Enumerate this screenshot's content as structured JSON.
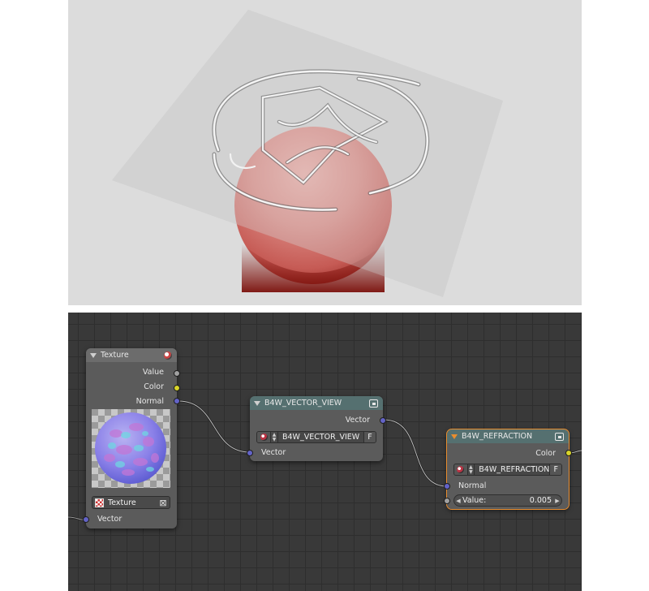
{
  "viewport": {
    "colors": {
      "background": "#dcdcdc",
      "sphere": "#c86a6a",
      "sphere_shadow": "#8a1a14",
      "glass_plane": "#cfcfcf"
    }
  },
  "node_editor": {
    "colors": {
      "grid": "#393939",
      "node_body": "#5b5b5b",
      "active_outline": "#e98d2e",
      "socket_vector": "#6363c7",
      "socket_color": "#d8d42a",
      "socket_value": "#a1a1a1"
    },
    "texture_node": {
      "title": "Texture",
      "outputs": [
        "Value",
        "Color",
        "Normal"
      ],
      "texture_name": "Texture",
      "input": "Vector"
    },
    "vector_view_node": {
      "title": "B4W_VECTOR_VIEW",
      "output": "Vector",
      "group_name": "B4W_VECTOR_VIEW",
      "fake_user": "F",
      "input": "Vector"
    },
    "refraction_node": {
      "title": "B4W_REFRACTION",
      "output": "Color",
      "group_name": "B4W_REFRACTION",
      "fake_user": "F",
      "input_normal": "Normal",
      "value_label": "Value:",
      "value": "0.005"
    }
  }
}
